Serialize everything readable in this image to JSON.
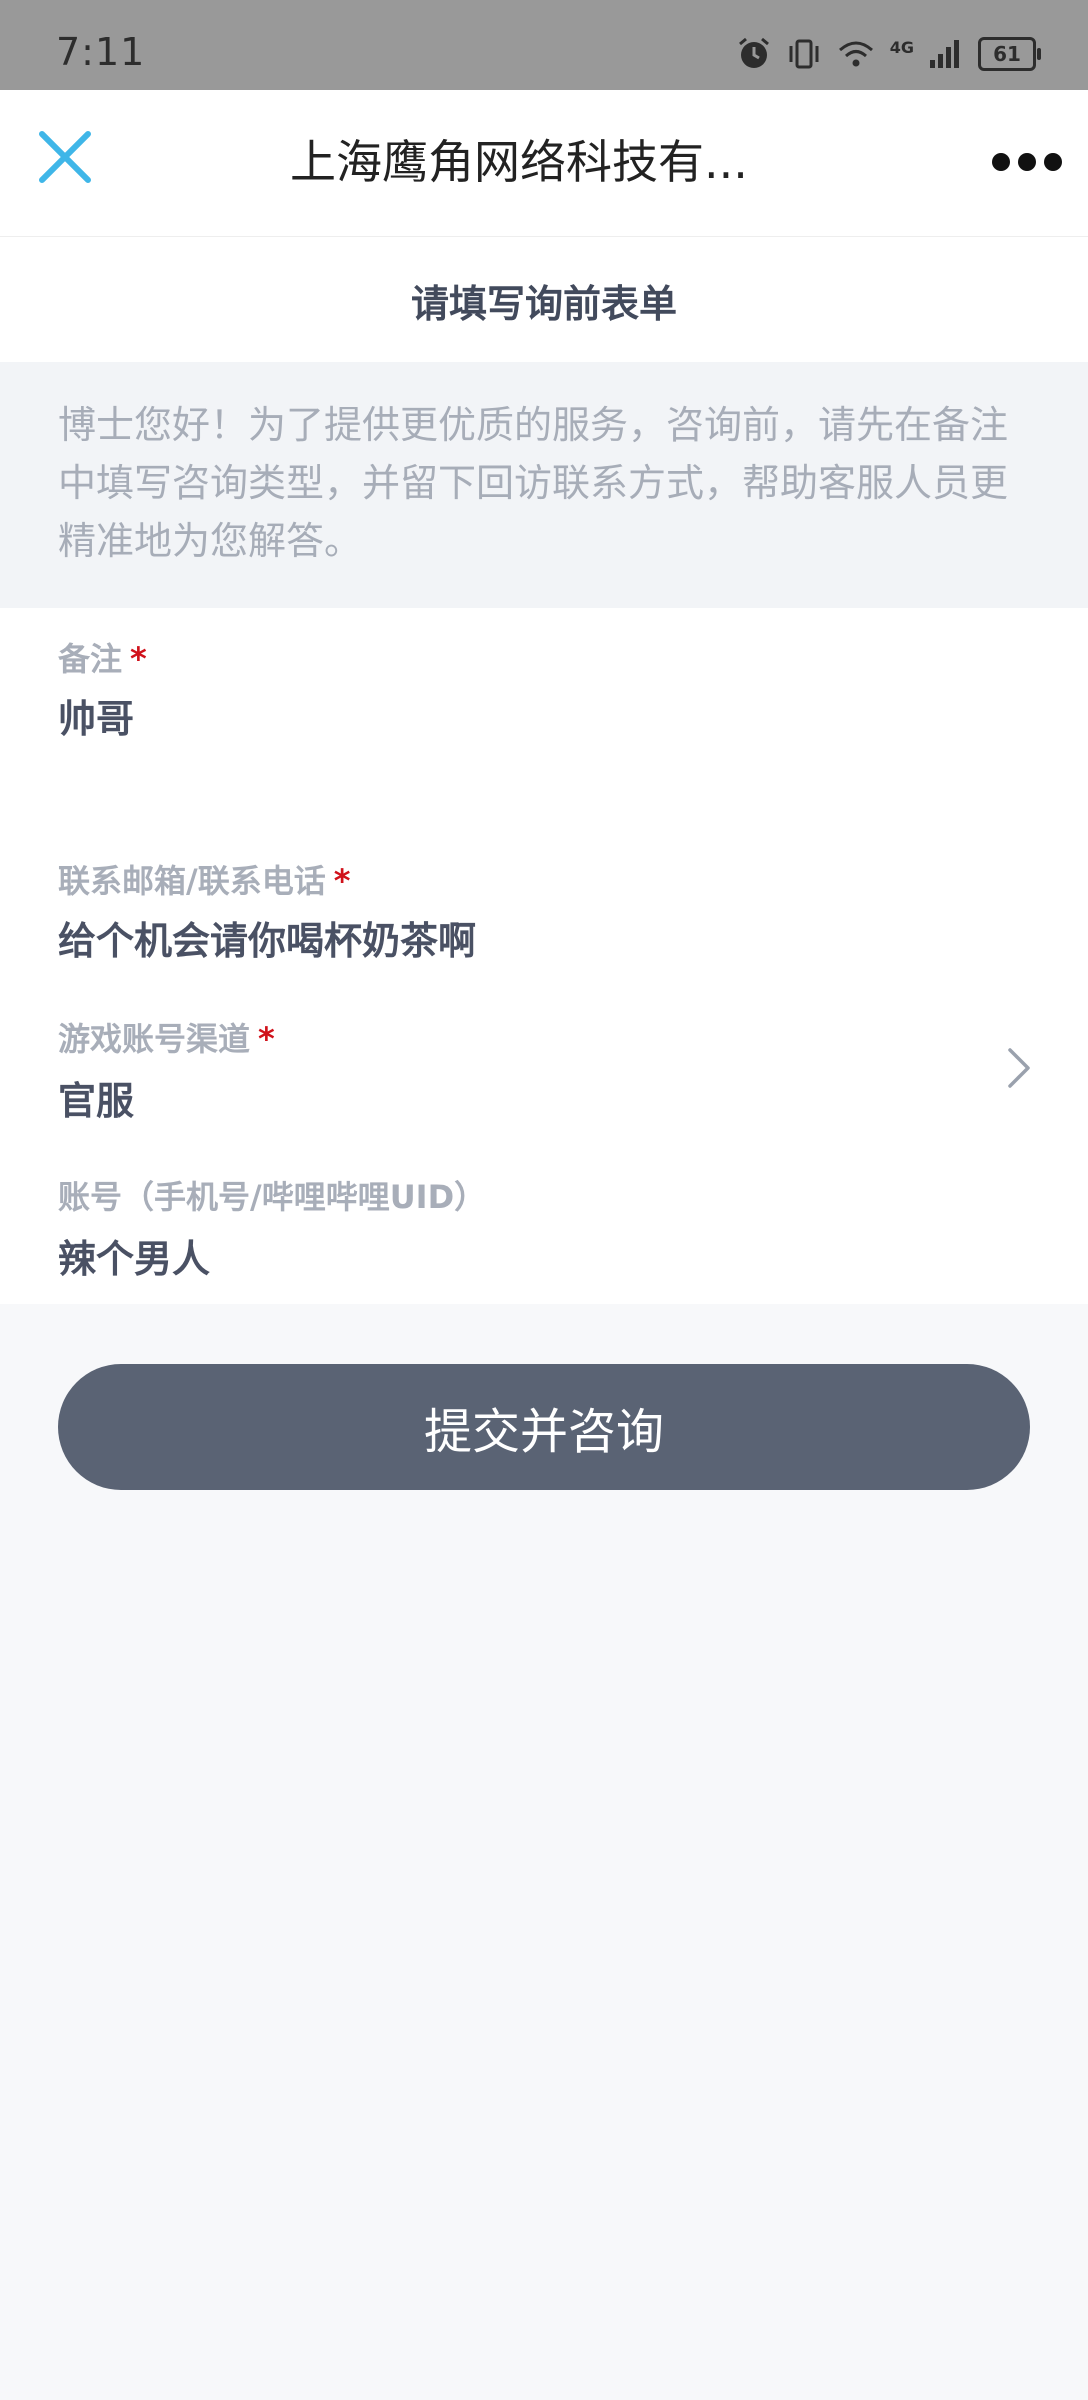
{
  "status_bar": {
    "time": "7:11",
    "battery": "61",
    "network": "4G"
  },
  "nav": {
    "title": "上海鹰角网络科技有...",
    "close_icon": "close-icon",
    "more_icon": "more-dots-icon"
  },
  "form": {
    "header_title": "请填写询前表单",
    "notice": "博士您好！为了提供更优质的服务，咨询前，请先在备注中填写咨询类型，并留下回访联系方式，帮助客服人员更精准地为您解答。",
    "fields": [
      {
        "label": "备注",
        "required_mark": "*",
        "value": "帅哥"
      },
      {
        "label": "联系邮箱/联系电话",
        "required_mark": "*",
        "value": "给个机会请你喝杯奶茶啊"
      },
      {
        "label": "游戏账号渠道",
        "required_mark": "*",
        "value": "官服"
      },
      {
        "label": "账号（手机号/哔哩哔哩UID）",
        "value": "辣个男人"
      }
    ],
    "submit_label": "提交并咨询"
  },
  "colors": {
    "accent_close": "#3fb6e8",
    "required": "#d0121b",
    "button_bg": "#5a6374"
  }
}
